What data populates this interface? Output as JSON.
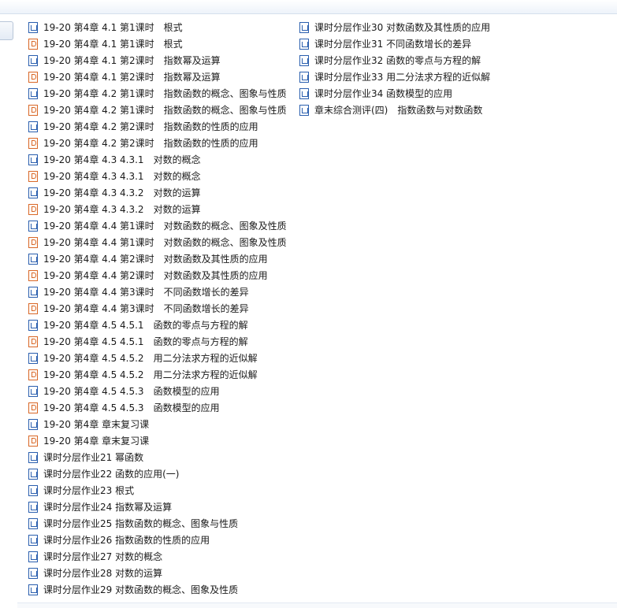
{
  "files": {
    "col1": [
      {
        "icon": "word-doc-icon",
        "type": "doc",
        "name": "19-20 第4章 4.1 第1课时　根式"
      },
      {
        "icon": "ppt-icon",
        "type": "ppt",
        "name": "19-20 第4章 4.1 第1课时　根式"
      },
      {
        "icon": "word-doc-icon",
        "type": "doc",
        "name": "19-20 第4章 4.1 第2课时　指数幂及运算"
      },
      {
        "icon": "ppt-icon",
        "type": "ppt",
        "name": "19-20 第4章 4.1 第2课时　指数幂及运算"
      },
      {
        "icon": "word-doc-icon",
        "type": "doc",
        "name": "19-20 第4章 4.2 第1课时　指数函数的概念、图象与性质"
      },
      {
        "icon": "ppt-icon",
        "type": "ppt",
        "name": "19-20 第4章 4.2 第1课时　指数函数的概念、图象与性质"
      },
      {
        "icon": "word-doc-icon",
        "type": "doc",
        "name": "19-20 第4章 4.2 第2课时　指数函数的性质的应用"
      },
      {
        "icon": "ppt-icon",
        "type": "ppt",
        "name": "19-20 第4章 4.2 第2课时　指数函数的性质的应用"
      },
      {
        "icon": "word-doc-icon",
        "type": "doc",
        "name": "19-20 第4章 4.3 4.3.1　对数的概念"
      },
      {
        "icon": "ppt-icon",
        "type": "ppt",
        "name": "19-20 第4章 4.3 4.3.1　对数的概念"
      },
      {
        "icon": "word-doc-icon",
        "type": "doc",
        "name": "19-20 第4章 4.3 4.3.2　对数的运算"
      },
      {
        "icon": "ppt-icon",
        "type": "ppt",
        "name": "19-20 第4章 4.3 4.3.2　对数的运算"
      },
      {
        "icon": "word-doc-icon",
        "type": "doc",
        "name": "19-20 第4章 4.4 第1课时　对数函数的概念、图象及性质"
      },
      {
        "icon": "ppt-icon",
        "type": "ppt",
        "name": "19-20 第4章 4.4 第1课时　对数函数的概念、图象及性质"
      },
      {
        "icon": "word-doc-icon",
        "type": "doc",
        "name": "19-20 第4章 4.4 第2课时　对数函数及其性质的应用"
      },
      {
        "icon": "ppt-icon",
        "type": "ppt",
        "name": "19-20 第4章 4.4 第2课时　对数函数及其性质的应用"
      },
      {
        "icon": "word-doc-icon",
        "type": "doc",
        "name": "19-20 第4章 4.4 第3课时　不同函数增长的差异"
      },
      {
        "icon": "ppt-icon",
        "type": "ppt",
        "name": "19-20 第4章 4.4 第3课时　不同函数增长的差异"
      },
      {
        "icon": "word-doc-icon",
        "type": "doc",
        "name": "19-20 第4章 4.5 4.5.1　函数的零点与方程的解"
      },
      {
        "icon": "ppt-icon",
        "type": "ppt",
        "name": "19-20 第4章 4.5 4.5.1　函数的零点与方程的解"
      },
      {
        "icon": "word-doc-icon",
        "type": "doc",
        "name": "19-20 第4章 4.5 4.5.2　用二分法求方程的近似解"
      },
      {
        "icon": "ppt-icon",
        "type": "ppt",
        "name": "19-20 第4章 4.5 4.5.2　用二分法求方程的近似解"
      },
      {
        "icon": "word-doc-icon",
        "type": "doc",
        "name": "19-20 第4章 4.5 4.5.3　函数模型的应用"
      },
      {
        "icon": "ppt-icon",
        "type": "ppt",
        "name": "19-20 第4章 4.5 4.5.3　函数模型的应用"
      },
      {
        "icon": "word-doc-icon",
        "type": "doc",
        "name": "19-20 第4章 章末复习课"
      },
      {
        "icon": "ppt-icon",
        "type": "ppt",
        "name": "19-20 第4章 章末复习课"
      },
      {
        "icon": "word-doc-icon",
        "type": "doc",
        "name": "课时分层作业21 幂函数"
      },
      {
        "icon": "word-doc-icon",
        "type": "doc",
        "name": "课时分层作业22 函数的应用(一)"
      },
      {
        "icon": "word-doc-icon",
        "type": "doc",
        "name": "课时分层作业23 根式"
      },
      {
        "icon": "word-doc-icon",
        "type": "doc",
        "name": "课时分层作业24 指数幂及运算"
      },
      {
        "icon": "word-doc-icon",
        "type": "doc",
        "name": "课时分层作业25 指数函数的概念、图象与性质"
      },
      {
        "icon": "word-doc-icon",
        "type": "doc",
        "name": "课时分层作业26 指数函数的性质的应用"
      },
      {
        "icon": "word-doc-icon",
        "type": "doc",
        "name": "课时分层作业27 对数的概念"
      },
      {
        "icon": "word-doc-icon",
        "type": "doc",
        "name": "课时分层作业28 对数的运算"
      },
      {
        "icon": "word-doc-icon",
        "type": "doc",
        "name": "课时分层作业29 对数函数的概念、图象及性质"
      }
    ],
    "col2": [
      {
        "icon": "word-doc-icon",
        "type": "doc",
        "name": "课时分层作业30 对数函数及其性质的应用"
      },
      {
        "icon": "word-doc-icon",
        "type": "doc",
        "name": "课时分层作业31 不同函数增长的差异"
      },
      {
        "icon": "word-doc-icon",
        "type": "doc",
        "name": "课时分层作业32 函数的零点与方程的解"
      },
      {
        "icon": "word-doc-icon",
        "type": "doc",
        "name": "课时分层作业33 用二分法求方程的近似解"
      },
      {
        "icon": "word-doc-icon",
        "type": "doc",
        "name": "课时分层作业34 函数模型的应用"
      },
      {
        "icon": "word-doc-icon",
        "type": "doc",
        "name": "章末综合测评(四)　指数函数与对数函数"
      }
    ]
  },
  "colors": {
    "doc_icon": "#2b5fae",
    "ppt_icon": "#d9692a",
    "topbar": "#eef3fa"
  }
}
